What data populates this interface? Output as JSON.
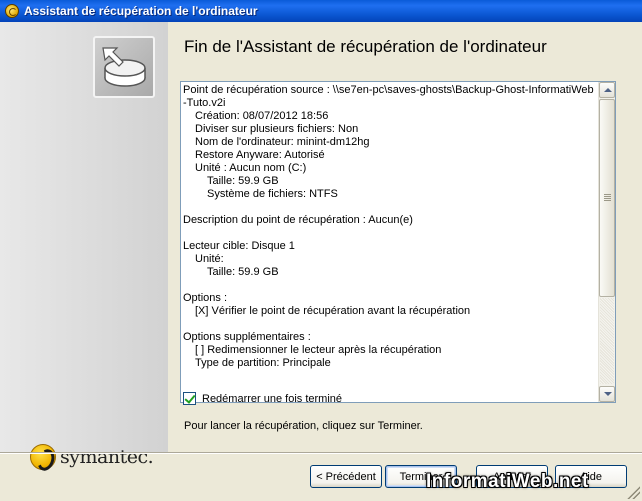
{
  "window": {
    "title": "Assistant de récupération de l'ordinateur"
  },
  "sidebar": {
    "logo_text": "symantec."
  },
  "main": {
    "heading": "Fin de l'Assistant de récupération de l'ordinateur",
    "summary": {
      "source_line1": "Point de récupération source :  \\\\se7en-pc\\saves-ghosts\\Backup-Ghost-InformatiWeb",
      "source_line2": "-Tuto.v2i",
      "creation": "Création:  08/07/2012 18:56",
      "split": "Diviser sur plusieurs fichiers:  Non",
      "computer_name": "Nom de l'ordinateur:  minint-dm12hg",
      "restore_anyware": "Restore Anyware:  Autorisé",
      "unit_line": "Unité :  Aucun nom (C:)",
      "unit_size": "Taille:  59.9 GB",
      "filesystem": "Système de fichiers:  NTFS",
      "description": "Description du point de récupération :     Aucun(e)",
      "target_drive": "Lecteur cible:  Disque 1",
      "target_unit": "Unité:",
      "target_size": "Taille:  59.9 GB",
      "options_label": "Options :",
      "option_verify": "[X] Vérifier le point de récupération avant la récupération",
      "extra_options_label": "Options supplémentaires :",
      "option_resize": "[ ] Redimensionner le lecteur après la récupération",
      "partition_type": "Type de partition:  Principale"
    },
    "restart_checkbox": {
      "label": "Redémarrer une fois terminé",
      "checked": true
    },
    "instruction": "Pour lancer la récupération, cliquez sur Terminer."
  },
  "buttons": {
    "back": "< Précédent",
    "finish": "Terminer",
    "cancel": "Annuler",
    "help": "Aide"
  },
  "watermark": "InformatiWeb.net"
}
